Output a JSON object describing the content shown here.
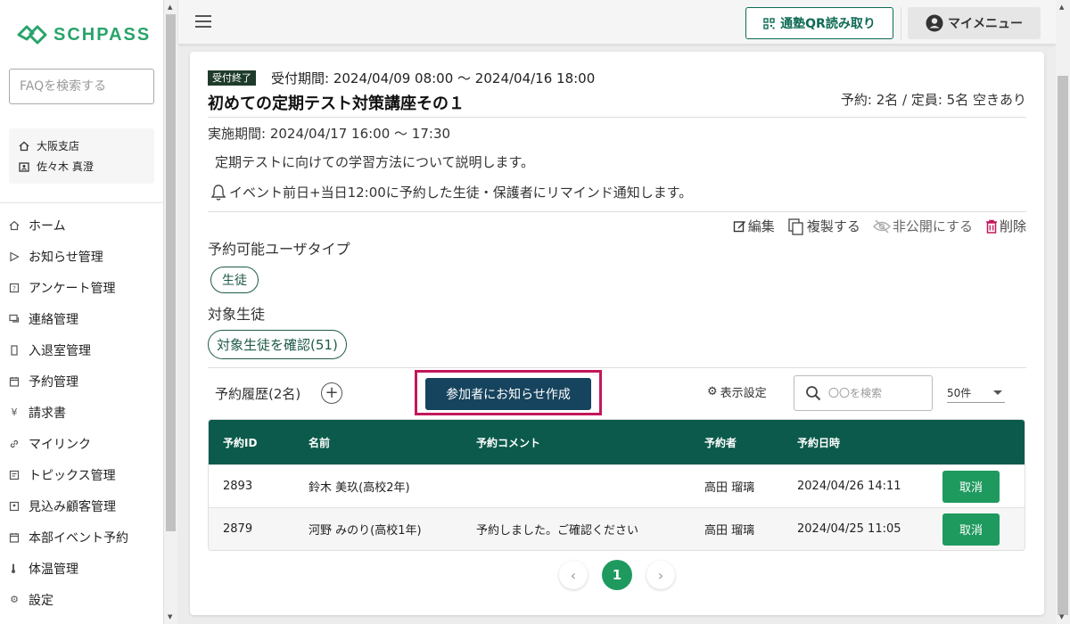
{
  "brand": {
    "logo_text": "SCHPASS",
    "accent": "#29a46a"
  },
  "sidebar": {
    "faq_placeholder": "FAQを検索する",
    "branch": "大阪支店",
    "user": "佐々木 真澄",
    "items": [
      {
        "label": "ホーム",
        "icon": "home-icon"
      },
      {
        "label": "お知らせ管理",
        "icon": "send-icon"
      },
      {
        "label": "アンケート管理",
        "icon": "survey-icon"
      },
      {
        "label": "連絡管理",
        "icon": "chat-icon"
      },
      {
        "label": "入退室管理",
        "icon": "door-icon"
      },
      {
        "label": "予約管理",
        "icon": "calendar-icon"
      },
      {
        "label": "請求書",
        "icon": "yen-icon"
      },
      {
        "label": "マイリンク",
        "icon": "link-icon"
      },
      {
        "label": "トピックス管理",
        "icon": "topics-icon"
      },
      {
        "label": "見込み顧客管理",
        "icon": "prospect-icon"
      },
      {
        "label": "本部イベント予約",
        "icon": "event-calendar-icon"
      },
      {
        "label": "体温管理",
        "icon": "thermometer-icon"
      },
      {
        "label": "設定",
        "icon": "gear-icon"
      }
    ]
  },
  "header": {
    "qr_button": "通塾QR読み取り",
    "my_menu": "マイメニュー"
  },
  "event": {
    "status_badge": "受付終了",
    "reception_period": "受付期間: 2024/04/09 08:00 〜 2024/04/16 18:00",
    "title": "初めての定期テスト対策講座その１",
    "capacity": "予約: 2名 / 定員: 5名 空きあり",
    "execution_period": "実施期間: 2024/04/17 16:00 〜 17:30",
    "description": "定期テストに向けての学習方法について説明します。",
    "reminder": "イベント前日+当日12:00に予約した生徒・保護者にリマインド通知します。"
  },
  "actions": {
    "edit": "編集",
    "duplicate": "複製する",
    "hide": "非公開にする",
    "delete": "削除"
  },
  "user_types": {
    "label": "予約可能ユーザタイプ",
    "chip": "生徒"
  },
  "target": {
    "label": "対象生徒",
    "button": "対象生徒を確認(51)"
  },
  "history": {
    "label": "予約履歴(2名)",
    "notify_button": "参加者にお知らせ作成",
    "display_settings": "表示設定",
    "search_placeholder": "〇〇を検索",
    "per_page": "50件"
  },
  "table": {
    "header_color": "#0b5a4b",
    "columns": [
      "予約ID",
      "名前",
      "予約コメント",
      "予約者",
      "予約日時"
    ],
    "rows": [
      {
        "id": "2893",
        "name": "鈴木 美玖(高校2年)",
        "comment": "",
        "booker": "高田 瑠璃",
        "datetime": "2024/04/26 14:11",
        "action": "取消"
      },
      {
        "id": "2879",
        "name": "河野 みのり(高校1年)",
        "comment": "予約しました。ご確認ください",
        "booker": "高田 瑠璃",
        "datetime": "2024/04/25 11:05",
        "action": "取消"
      }
    ]
  },
  "pagination": {
    "prev": "‹",
    "current": "1",
    "next": "›"
  }
}
